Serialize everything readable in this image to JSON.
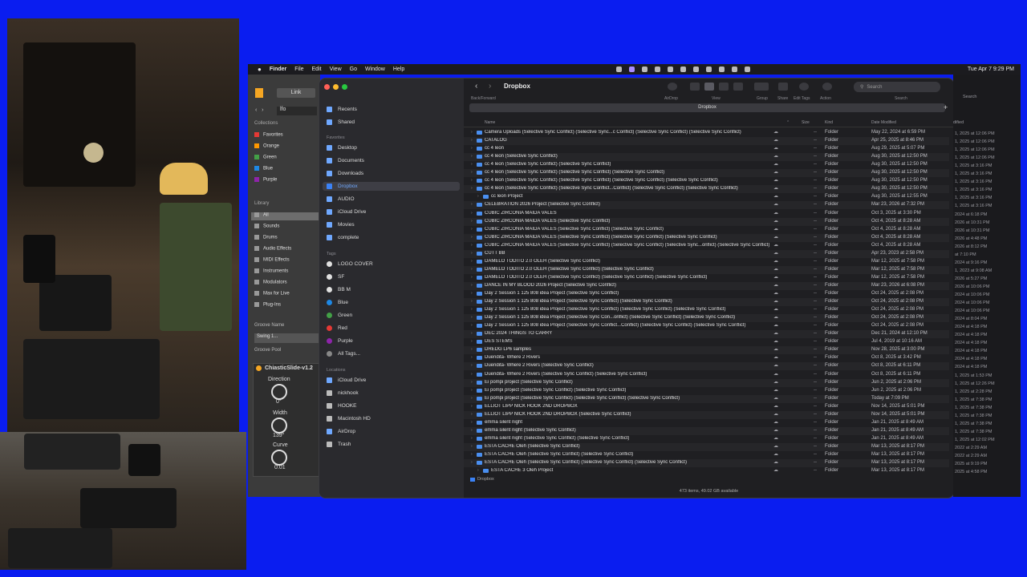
{
  "menubar": {
    "items": [
      "Finder",
      "File",
      "Edit",
      "View",
      "Go",
      "Window",
      "Help"
    ],
    "clock": "Tue Apr 7  9:29 PM"
  },
  "ableton": {
    "link_label": "Link",
    "lfo_label": "lfo",
    "collections_head": "Collections",
    "collections": [
      {
        "label": "Favorites",
        "color": "#e53935"
      },
      {
        "label": "Orange",
        "color": "#ff9800"
      },
      {
        "label": "Green",
        "color": "#43a047"
      },
      {
        "label": "Blue",
        "color": "#1e88e5"
      },
      {
        "label": "Purple",
        "color": "#8e24aa"
      }
    ],
    "library_head": "Library",
    "library": [
      "All",
      "Sounds",
      "Drums",
      "Audio Effects",
      "MIDI Effects",
      "Instruments",
      "Modulators",
      "Max for Live",
      "Plug-Ins"
    ],
    "groove_name_head": "Groove Name",
    "groove_item": "Swing 1...",
    "groove_pool": "Groove Pool",
    "device_name": "ChiasticSlide-v1.2",
    "direction_label": "Direction",
    "direction_value": "0°",
    "width_label": "Width",
    "width_value": "139°",
    "curve_label": "Curve",
    "curve_value": "0.01"
  },
  "finder": {
    "title": "Dropbox",
    "backforward_label": "Back/Forward",
    "toolbar_labels": {
      "airdrop": "AirDrop",
      "view": "View",
      "group": "Group",
      "share": "Share",
      "edit_tags": "Edit Tags",
      "action": "Action",
      "search": "Search"
    },
    "search_placeholder": "Search",
    "path_title": "Dropbox",
    "sidebar": {
      "top": [
        "Recents",
        "Shared"
      ],
      "favorites_head": "Favorites",
      "favorites": [
        "Desktop",
        "Documents",
        "Downloads",
        "Dropbox",
        "AUDIO",
        "iCloud Drive",
        "Movies",
        "complete"
      ],
      "tags_head": "Tags",
      "tags": [
        {
          "label": "LOGO COVER",
          "color": "#e0e0e0"
        },
        {
          "label": "SF",
          "color": "#e0e0e0"
        },
        {
          "label": "BB M",
          "color": "#e0e0e0"
        },
        {
          "label": "Blue",
          "color": "#1e88e5"
        },
        {
          "label": "Green",
          "color": "#43a047"
        },
        {
          "label": "Red",
          "color": "#e53935"
        },
        {
          "label": "Purple",
          "color": "#8e24aa"
        },
        {
          "label": "All Tags...",
          "color": "#888888"
        }
      ],
      "locations_head": "Locations",
      "locations": [
        "iCloud Drive",
        "nickhook",
        "HOOKE",
        "Macintosh HD",
        "AirDrop",
        "Trash"
      ]
    },
    "columns": {
      "name": "Name",
      "size": "Size",
      "kind": "Kind",
      "date": "Date Modified"
    },
    "rows": [
      {
        "name": "Camera Uploads (Selective Sync Conflict) (Selective Sync...c Conflict) (Selective Sync Conflict) (Selective Sync Conflict)",
        "date": "May 22, 2024 at 6:59 PM"
      },
      {
        "name": "CATALOG",
        "date": "Apr 25, 2025 at 8:46 PM"
      },
      {
        "name": "cc 4 leon",
        "date": "Aug 29, 2025 at 5:07 PM"
      },
      {
        "name": "cc 4 leon (Selective Sync Conflict)",
        "date": "Aug 30, 2025 at 12:50 PM"
      },
      {
        "name": "cc 4 leon (Selective Sync Conflict) (Selective Sync Conflict)",
        "date": "Aug 30, 2025 at 12:50 PM"
      },
      {
        "name": "cc 4 leon (Selective Sync Conflict) (Selective Sync Conflict) (Selective Sync Conflict)",
        "date": "Aug 30, 2025 at 12:50 PM"
      },
      {
        "name": "cc 4 leon (Selective Sync Conflict) (Selective Sync Conflict) (Selective Sync Conflict) (Selective Sync Conflict)",
        "date": "Aug 30, 2025 at 12:50 PM"
      },
      {
        "name": "cc 4 leon (Selective Sync Conflict) (Selective Sync Conflict...Conflict) (Selective Sync Conflict) (Selective Sync Conflict)",
        "date": "Aug 30, 2025 at 12:50 PM"
      },
      {
        "name": "cc leon Project",
        "date": "Aug 30, 2025 at 12:55 PM",
        "indent": true
      },
      {
        "name": "CELEBRATION 2026 Project (Selective Sync Conflict)",
        "date": "Mar 23, 2026 at 7:32 PM"
      },
      {
        "name": "CUBIC ZIRCONIA MAIDA VALES",
        "date": "Oct 3, 2025 at 3:30 PM"
      },
      {
        "name": "CUBIC ZIRCONIA MAIDA VALES (Selective Sync Conflict)",
        "date": "Oct 4, 2025 at 8:28 AM"
      },
      {
        "name": "CUBIC ZIRCONIA MAIDA VALES (Selective Sync Conflict) (Selective Sync Conflict)",
        "date": "Oct 4, 2025 at 8:28 AM"
      },
      {
        "name": "CUBIC ZIRCONIA MAIDA VALES (Selective Sync Conflict) (Selective Sync Conflict) (Selective Sync Conflict)",
        "date": "Oct 4, 2025 at 8:28 AM"
      },
      {
        "name": "CUBIC ZIRCONIA MAIDA VALES (Selective Sync Conflict) (Selective Sync Conflict) (Selective Sync...onflict) (Selective Sync Conflict)",
        "date": "Oct 4, 2025 at 8:28 AM"
      },
      {
        "name": "CUTT BB",
        "date": "Apr 23, 2023 at 2:58 PM"
      },
      {
        "name": "DAMELO TODITO 2.0 OLEH (Selective Sync Conflict)",
        "date": "Mar 12, 2025 at 7:58 PM"
      },
      {
        "name": "DAMELO TODITO 2.0 OLEH (Selective Sync Conflict) (Selective Sync Conflict)",
        "date": "Mar 12, 2025 at 7:58 PM"
      },
      {
        "name": "DAMELO TODITO 2.0 OLEH (Selective Sync Conflict) (Selective Sync Conflict) (Selective Sync Conflict)",
        "date": "Mar 12, 2025 at 7:58 PM"
      },
      {
        "name": "DANCE IN MY BLOOD 2026 Project (Selective Sync Conflict)",
        "date": "Mar 23, 2026 at 6:08 PM"
      },
      {
        "name": "Day 2 Session 1 125 808 idea Project (Selective Sync Conflict)",
        "date": "Oct 24, 2025 at 2:08 PM"
      },
      {
        "name": "Day 2 Session 1 125 808 idea Project (Selective Sync Conflict) (Selective Sync Conflict)",
        "date": "Oct 24, 2025 at 2:08 PM"
      },
      {
        "name": "Day 2 Session 1 125 808 idea Project (Selective Sync Conflict) (Selective Sync Conflict) (Selective Sync Conflict)",
        "date": "Oct 24, 2025 at 2:08 PM"
      },
      {
        "name": "Day 2 Session 1 125 808 idea Project (Selective Sync Con...onflict) (Selective Sync Conflict) (Selective Sync Conflict)",
        "date": "Oct 24, 2025 at 2:08 PM"
      },
      {
        "name": "Day 2 Session 1 125 808 idea Project (Selective Sync Conflict...Conflict) (Selective Sync Conflict) (Selective Sync Conflict)",
        "date": "Oct 24, 2025 at 2:08 PM"
      },
      {
        "name": "DEC 2024 THINGS TO CARRY",
        "date": "Dec 21, 2024 at 12:10 PM"
      },
      {
        "name": "DES STEMS",
        "date": "Jul 4, 2019 at 10:16 AM"
      },
      {
        "name": "DREDG LP6 samples",
        "date": "Nov 28, 2025 at 3:00 PM"
      },
      {
        "name": "Duendita- Where 2 Rivers",
        "date": "Oct 8, 2025 at 3:42 PM"
      },
      {
        "name": "Duendita- Where 2 Rivers (Selective Sync Conflict)",
        "date": "Oct 8, 2025 at 6:11 PM"
      },
      {
        "name": "Duendita- Where 2 Rivers (Selective Sync Conflict) (Selective Sync Conflict)",
        "date": "Oct 8, 2025 at 6:11 PM"
      },
      {
        "name": "Ei pompi project (Selective Sync Conflict)",
        "date": "Jun 2, 2025 at 2:06 PM"
      },
      {
        "name": "Ei pompi project (Selective Sync Conflict) (Selective Sync Conflict)",
        "date": "Jun 2, 2025 at 2:06 PM"
      },
      {
        "name": "Ei pompi project (Selective Sync Conflict) (Selective Sync Conflict) (Selective Sync Conflict)",
        "date": "Today at 7:09 PM"
      },
      {
        "name": "ELLIOT LIPP NICK HOOK 2ND DROPBOX",
        "date": "Nov 14, 2025 at 5:01 PM"
      },
      {
        "name": "ELLIOT LIPP NICK HOOK 2ND DROPBOX (Selective Sync Conflict)",
        "date": "Nov 14, 2025 at 5:01 PM"
      },
      {
        "name": "emma silent night",
        "date": "Jan 21, 2025 at 8:49 AM"
      },
      {
        "name": "emma silent night (Selective Sync Conflict)",
        "date": "Jan 21, 2025 at 8:49 AM"
      },
      {
        "name": "emma silent night (Selective Sync Conflict) (Selective Sync Conflict)",
        "date": "Jan 21, 2025 at 8:49 AM"
      },
      {
        "name": "ESTA CACHE Oleh (Selective Sync Conflict)",
        "date": "Mar 13, 2025 at 8:17 PM"
      },
      {
        "name": "ESTA CACHE Oleh (Selective Sync Conflict) (Selective Sync Conflict)",
        "date": "Mar 13, 2025 at 8:17 PM"
      },
      {
        "name": "ESTA CACHE Oleh (Selective Sync Conflict) (Selective Sync Conflict) (Selective Sync Conflict)",
        "date": "Mar 13, 2025 at 8:17 PM"
      },
      {
        "name": "ESTA CACHE 3 Oleh Project",
        "date": "Mar 13, 2025 at 8:17 PM",
        "indent": true
      }
    ],
    "size_placeholder": "--",
    "kind_value": "Folder",
    "bottom_path": "Dropbox",
    "status": "473 items, 49.02 GB available"
  },
  "behind_window": {
    "search_label": "Search",
    "col_label": "dified",
    "dates": [
      "1, 2025 at 12:06 PM",
      "1, 2025 at 12:06 PM",
      "1, 2025 at 12:06 PM",
      "1, 2025 at 12:06 PM",
      "1, 2025 at 3:16 PM",
      "1, 2025 at 3:16 PM",
      "1, 2025 at 3:16 PM",
      "1, 2025 at 3:16 PM",
      "1, 2025 at 3:16 PM",
      "1, 2025 at 3:16 PM",
      "2024 at 6:18 PM",
      "2026 at 10:31 PM",
      "2026 at 10:31 PM",
      "2026 at 4:48 PM",
      "2026 at 8:12 PM",
      "at 7:10 PM",
      "2024 at 9:16 PM",
      "1, 2023 at 9:08 AM",
      "2026 at 5:27 PM",
      "2026 at 10:06 PM",
      "2024 at 10:06 PM",
      "2024 at 10:06 PM",
      "2024 at 10:06 PM",
      "2024 at 8:04 PM",
      "2024 at 4:18 PM",
      "2024 at 4:18 PM",
      "2024 at 4:18 PM",
      "2024 at 4:18 PM",
      "2024 at 4:18 PM",
      "2024 at 4:18 PM",
      "1, 2025 at 1:53 PM",
      "1, 2025 at 12:26 PM",
      "1, 2025 at 2:28 PM",
      "1, 2025 at 7:38 PM",
      "1, 2025 at 7:38 PM",
      "1, 2025 at 7:38 PM",
      "1, 2025 at 7:38 PM",
      "1, 2025 at 7:38 PM",
      "1, 2025 at 12:02 PM",
      "2022 at 2:29 AM",
      "2022 at 2:29 AM",
      "2025 at 9:19 PM",
      "2025 at 4:58 PM"
    ]
  }
}
